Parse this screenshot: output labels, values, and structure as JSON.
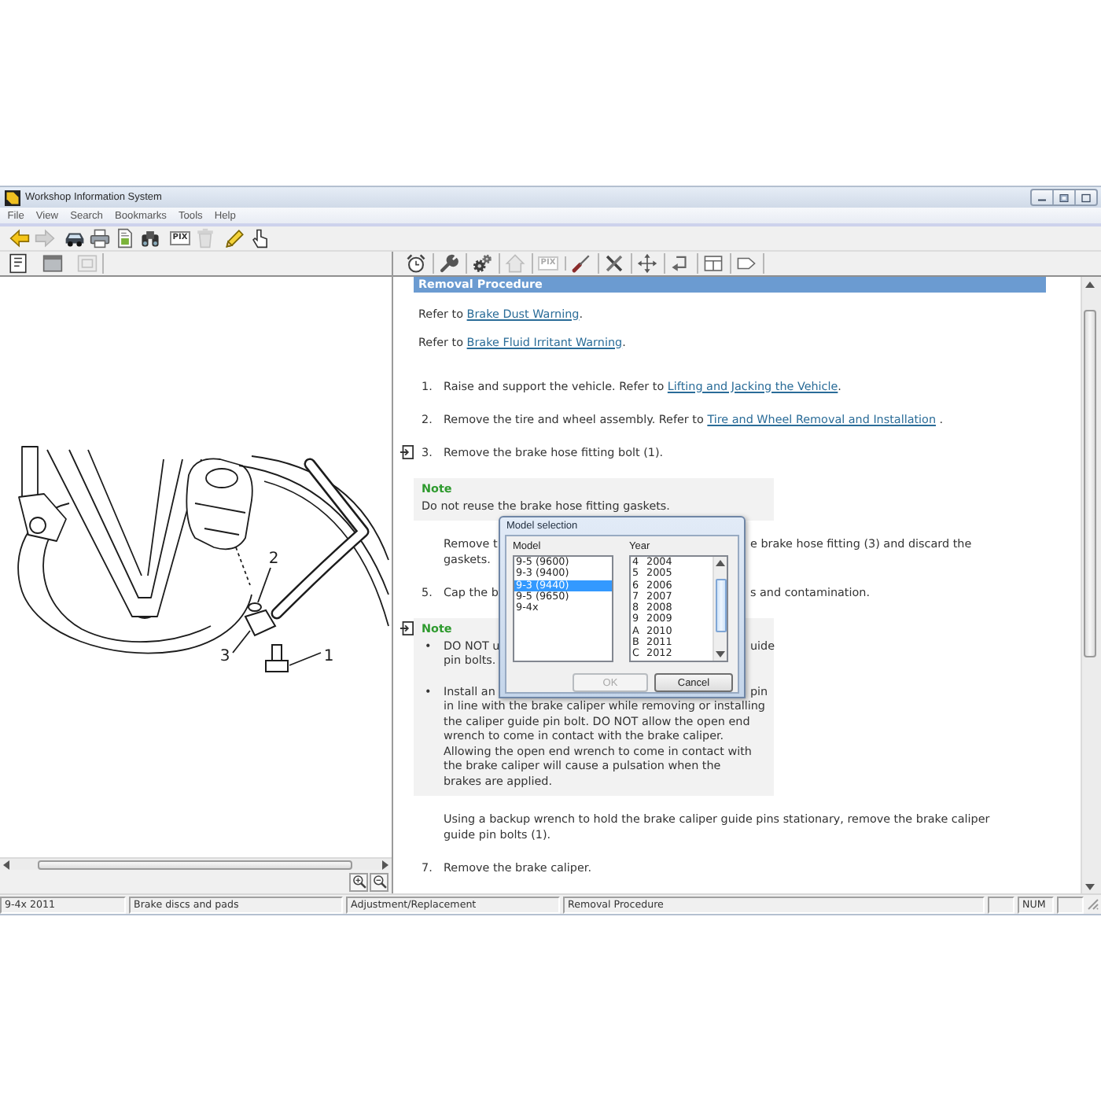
{
  "window": {
    "title": "Workshop Information System"
  },
  "menu": [
    "File",
    "View",
    "Search",
    "Bookmarks",
    "Tools",
    "Help"
  ],
  "main_toolbar": [
    {
      "kind": "icon",
      "disabled": false
    },
    {
      "kind": "icon",
      "disabled": true
    },
    {
      "kind": "icon",
      "disabled": false
    },
    {
      "kind": "icon",
      "disabled": false
    },
    {
      "kind": "icon",
      "disabled": false
    },
    {
      "kind": "icon",
      "disabled": false
    },
    {
      "kind": "text",
      "label": "PIX",
      "disabled": false
    },
    {
      "kind": "icon",
      "disabled": true
    },
    {
      "kind": "icon",
      "disabled": false
    },
    {
      "kind": "icon",
      "disabled": false
    }
  ],
  "view_toolbar": [
    {
      "kind": "icon",
      "disabled": false
    },
    {
      "kind": "icon",
      "disabled": false
    },
    {
      "kind": "icon",
      "disabled": true
    }
  ],
  "document_toolbar": [
    {
      "kind": "icon",
      "disabled": false
    },
    {
      "kind": "icon",
      "disabled": false
    },
    {
      "kind": "icon",
      "disabled": false
    },
    {
      "kind": "icon",
      "disabled": true
    },
    {
      "kind": "text",
      "label": "PIX",
      "disabled": true
    },
    {
      "kind": "icon",
      "disabled": false
    },
    {
      "kind": "icon",
      "disabled": false
    },
    {
      "kind": "icon",
      "disabled": false
    },
    {
      "kind": "icon",
      "disabled": false
    },
    {
      "kind": "icon",
      "disabled": false
    },
    {
      "kind": "icon",
      "disabled": false
    }
  ],
  "illustration": {
    "callouts": [
      {
        "label": "2"
      },
      {
        "label": "3"
      },
      {
        "label": "1"
      }
    ]
  },
  "document": {
    "heading": "Removal Procedure",
    "blocks": [
      {
        "kind": "paragraph",
        "figure_link": false,
        "lines": [
          {
            "segments": [
              {
                "text": "Refer to "
              },
              {
                "link": "Brake Dust Warning"
              },
              {
                "text": "."
              }
            ]
          }
        ]
      },
      {
        "kind": "paragraph",
        "figure_link": false,
        "lines": [
          {
            "segments": [
              {
                "text": "Refer to "
              },
              {
                "link": "Brake Fluid Irritant Warning"
              },
              {
                "text": "."
              }
            ]
          }
        ]
      },
      {
        "kind": "step",
        "figure_link": false,
        "number": "1.",
        "lines": [
          {
            "segments": [
              {
                "text": "Raise and support the vehicle. Refer to "
              },
              {
                "link": "Lifting and Jacking the Vehicle"
              },
              {
                "text": "."
              }
            ]
          }
        ]
      },
      {
        "kind": "step",
        "figure_link": false,
        "number": "2.",
        "lines": [
          {
            "segments": [
              {
                "text": "Remove the tire and wheel assembly. Refer to "
              },
              {
                "link": "Tire and Wheel Removal and Installation"
              },
              {
                "text": " ."
              }
            ]
          }
        ]
      },
      {
        "kind": "step",
        "figure_link": true,
        "number": "3.",
        "lines": [
          {
            "text": "Remove the brake hose fitting bolt (1)."
          }
        ]
      },
      {
        "kind": "note",
        "figure_link": false,
        "label": "Note",
        "lines": [
          {
            "text": "Do not reuse the brake hose fitting gaskets."
          }
        ]
      },
      {
        "kind": "step",
        "figure_link": false,
        "lines": [
          {
            "text": "Remove t",
            "text_after": "e brake hose fitting (3) and discard the"
          },
          {
            "text": "gaskets."
          }
        ]
      },
      {
        "kind": "step",
        "figure_link": false,
        "number": "5.",
        "lines": [
          {
            "text": "Cap the b",
            "text_after": "s and contamination."
          }
        ]
      },
      {
        "kind": "note",
        "figure_link": true,
        "label": "Note",
        "bullets": [
          {
            "marker": "•",
            "lines": [
              {
                "text": "DO NOT u",
                "text_after": "uide"
              },
              {
                "text": "pin bolts."
              }
            ]
          },
          {
            "marker": "•",
            "lines": [
              {
                "text": "Install an",
                "text_after": "pin"
              },
              {
                "text": "in line with the brake caliper while removing or installing"
              },
              {
                "text": "the caliper guide pin bolt. DO NOT allow the open end"
              },
              {
                "text": "wrench to come in contact with the brake caliper."
              },
              {
                "text": "Allowing the open end wrench to come in contact with"
              },
              {
                "text": "the brake caliper will cause a pulsation when the"
              },
              {
                "text": "brakes are applied."
              }
            ]
          }
        ]
      },
      {
        "kind": "step",
        "figure_link": false,
        "lines": [
          {
            "text": "Using a backup wrench to hold the brake caliper guide pins stationary, remove the brake caliper"
          },
          {
            "text": "guide pin bolts (1)."
          }
        ]
      },
      {
        "kind": "step",
        "figure_link": false,
        "number": "7.",
        "lines": [
          {
            "text": "Remove the brake caliper."
          }
        ]
      }
    ]
  },
  "dialog": {
    "title": "Model selection",
    "model_label": "Model",
    "models": [
      {
        "label": "9-5 (9600)",
        "selected": false
      },
      {
        "label": "9-3 (9400)",
        "selected": false
      },
      {
        "label": "9-3 (9440)",
        "selected": true
      },
      {
        "label": "9-5 (9650)",
        "selected": false
      },
      {
        "label": "9-4x",
        "selected": false
      }
    ],
    "year_label": "Year",
    "years": [
      {
        "code": "4",
        "year": "2004",
        "selected": false
      },
      {
        "code": "5",
        "year": "2005",
        "selected": false
      },
      {
        "code": "6",
        "year": "2006",
        "selected": false
      },
      {
        "code": "7",
        "year": "2007",
        "selected": false
      },
      {
        "code": "8",
        "year": "2008",
        "selected": false
      },
      {
        "code": "9",
        "year": "2009",
        "selected": false
      },
      {
        "code": "A",
        "year": "2010",
        "selected": false
      },
      {
        "code": "B",
        "year": "2011",
        "selected": false
      },
      {
        "code": "C",
        "year": "2012",
        "selected": false
      }
    ],
    "buttons": [
      {
        "label": "OK",
        "disabled": true
      },
      {
        "label": "Cancel",
        "disabled": false
      }
    ]
  },
  "status_bar": {
    "fields": [
      "9-4x 2011",
      "Brake discs and pads",
      "Adjustment/Replacement",
      "Removal Procedure",
      "NUM"
    ]
  }
}
